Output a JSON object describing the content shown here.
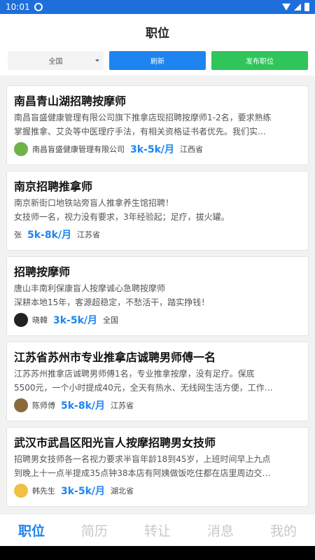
{
  "statusbar": {
    "time": "10:01"
  },
  "header": {
    "title": "职位"
  },
  "toolbar": {
    "filter_value": "全国",
    "refresh_label": "刷新",
    "post_label": "发布职位"
  },
  "jobs": [
    {
      "title": "南昌青山湖招聘按摩师",
      "lines": [
        "南昌盲盛健康管理有限公司旗下推拿店现招聘按摩师1-2名，要求熟练",
        "掌握推拿、艾灸等中医理疗手法，有相关资格证书者优先。我们实…"
      ],
      "company": "南昌盲盛健康管理有限公司",
      "salary": "3k-5k/月",
      "region": "江西省",
      "avatar_color": "#6fb24a"
    },
    {
      "title": "南京招聘推拿师",
      "lines": [
        "南京新街口地铁站旁盲人推拿养生馆招聘！",
        "女技师一名，视力没有要求，3年经验起；足疗，拔火罐。"
      ],
      "company": "张",
      "salary": "5k-8k/月",
      "region": "江苏省",
      "avatar_color": ""
    },
    {
      "title": "招聘按摩师",
      "lines": [
        "唐山丰南利保康盲人按摩诚心急聘按摩师",
        "深耕本地15年，客源超稳定，不愁活干，踏实挣钱！"
      ],
      "company": "晓韓",
      "salary": "3k-5k/月",
      "region": "全国",
      "avatar_color": "#222222"
    },
    {
      "title": "江苏省苏州市专业推拿店诚聘男师傅一名",
      "lines": [
        "江苏苏州推拿店诚聘男师傅1名，专业推拿按摩，没有足疗。保底",
        "5500元，一个小时提成40元，全天有热水、无线网生活方便，工作…"
      ],
      "company": "陈师傅",
      "salary": "5k-8k/月",
      "region": "江苏省",
      "avatar_color": "#8a6a3a"
    },
    {
      "title": "武汉市武昌区阳光盲人按摩招聘男女技师",
      "lines": [
        "招聘男女技师各一名视力要求半盲年龄18到45岁，上班时间早上九点",
        "到晚上十一点半提成35点钟38本店有阿姨做饭吃住都在店里周边交…"
      ],
      "company": "韩先生",
      "salary": "3k-5k/月",
      "region": "湖北省",
      "avatar_color": "#f0c040"
    }
  ],
  "tabs": [
    {
      "label": "职位",
      "active": true
    },
    {
      "label": "简历",
      "active": false
    },
    {
      "label": "转让",
      "active": false
    },
    {
      "label": "消息",
      "active": false
    },
    {
      "label": "我的",
      "active": false
    }
  ]
}
